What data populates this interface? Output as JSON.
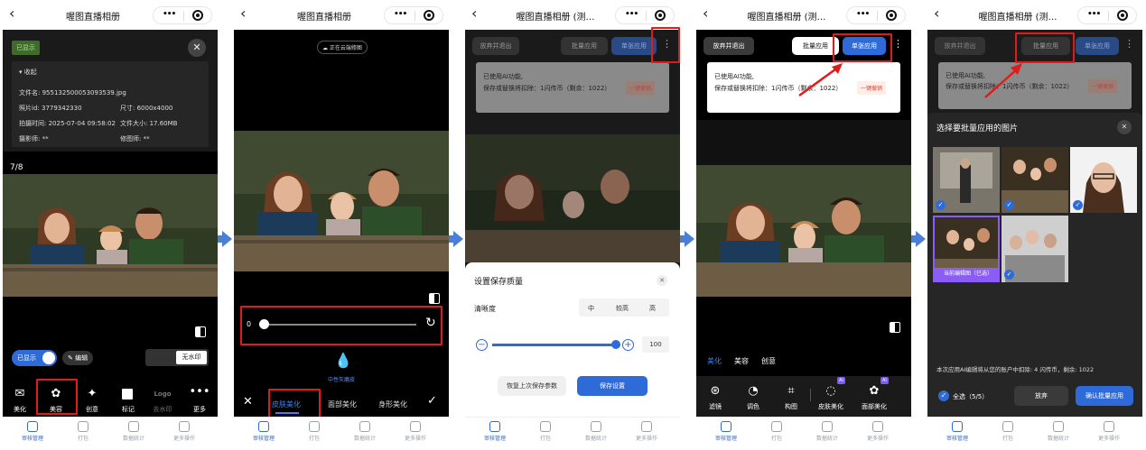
{
  "common": {
    "back": "‹",
    "more_dots": "•••",
    "tabs": [
      "审核管理",
      "打包",
      "数据统计",
      "更多操作"
    ],
    "colors": {
      "accent": "#2f6bd8",
      "danger": "#e01b1b",
      "ai_badge": "#7c5cf6"
    }
  },
  "s1": {
    "title": "喔图直播相册",
    "shown_tag": "已显示",
    "collapse": "收起",
    "info": {
      "filename_label": "文件名:",
      "filename": "955132500053093539.jpg",
      "photoid_label": "照片id:",
      "photoid": "3779342330",
      "size_label": "尺寸:",
      "size": "6000x4000",
      "shot_label": "拍摄时间:",
      "shot": "2025-07-04 09:58:02",
      "filesize_label": "文件大小:",
      "filesize": "17.60MB",
      "photographer_label": "摄影师:",
      "photographer": "**",
      "retoucher_label": "修图师:",
      "retoucher": "**"
    },
    "counter": "7/8",
    "shown_toggle": "已显示",
    "edit": "编辑",
    "nowatermark": "无水印",
    "tools": [
      "美化",
      "美容",
      "创意",
      "标记",
      "去水印",
      "更多"
    ],
    "logo": "Logo"
  },
  "s2": {
    "title": "喔图直播相册",
    "cloud": "正在云端修图",
    "slider_value": "0",
    "effect": "中性灰磨皮",
    "tabs": [
      "皮肤美化",
      "面部美化",
      "身形美化"
    ]
  },
  "s3": {
    "title": "喔图直播相册 (测…",
    "quit": "放弃并退出",
    "batch": "批量应用",
    "single": "单张应用",
    "ai_used": "已使用AI功能,",
    "ai_cost": "保存或替换将扣除：1闪传币（剩余：1022）",
    "undo": "一键撤销",
    "sheet_title": "设置保存质量",
    "clarity": "清晰度",
    "q_options": [
      "中",
      "较高",
      "高"
    ],
    "quality_value": "100",
    "restore": "恢复上次保存参数",
    "save": "保存设置"
  },
  "s4": {
    "title": "喔图直播相册 (测…",
    "quit": "放弃并退出",
    "batch": "批量应用",
    "single": "单张应用",
    "ai_used": "已使用AI功能,",
    "ai_cost": "保存或替换将扣除：1闪传币（剩余：1022）",
    "undo": "一键撤销",
    "cats": [
      "美化",
      "美容",
      "创意"
    ],
    "tools": [
      "滤镜",
      "调色",
      "构图",
      "皮肤美化",
      "面部美化"
    ],
    "ai": "AI"
  },
  "s5": {
    "title": "喔图直播相册 (测…",
    "quit": "放弃并退出",
    "batch": "批量应用",
    "single": "单张应用",
    "ai_used": "已使用AI功能,",
    "ai_cost": "保存或替换将扣除：1闪传币（剩余：1022）",
    "undo": "一键撤销",
    "dlg_title": "选择要批量应用的图片",
    "current": "当前编辑图（已选）",
    "notice": "本次应用AI编辑将从您的账户中扣除: 4 闪传币，剩余: 1022",
    "select_all": "全选（5/5）",
    "discard": "放弃",
    "confirm": "确认批量应用"
  }
}
